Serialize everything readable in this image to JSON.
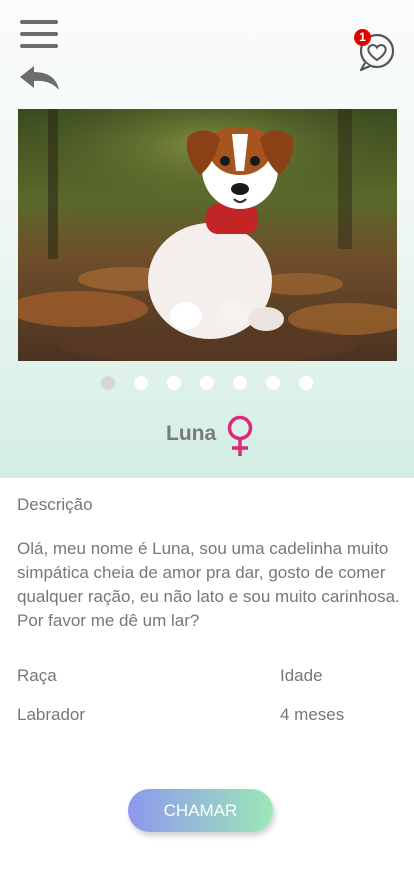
{
  "header": {
    "menu_icon": "hamburger-menu-icon",
    "back_icon": "reply-arrow-icon",
    "favorites_icon": "heart-chat-icon",
    "favorites_badge": "1"
  },
  "pet": {
    "name": "Luna",
    "gender_icon": "female-symbol-icon",
    "photo": "puppy-photo",
    "carousel": {
      "count": 7,
      "active_index": 0
    }
  },
  "details": {
    "description_label": "Descrição",
    "description": "Olá, meu nome é Luna, sou uma cadelinha muito simpática cheia de amor pra dar, gosto de comer qualquer ração, eu não lato e sou muito carinhosa. Por favor me dê um lar?",
    "breed_label": "Raça",
    "breed_value": "Labrador",
    "age_label": "Idade",
    "age_value": "4 meses"
  },
  "actions": {
    "call_label": "CHAMAR"
  },
  "colors": {
    "badge": "#e00000",
    "gender": "#e0287a",
    "button_start": "#8d98ee",
    "button_end": "#9ce8b6",
    "header_bottom": "#d3eee4"
  }
}
